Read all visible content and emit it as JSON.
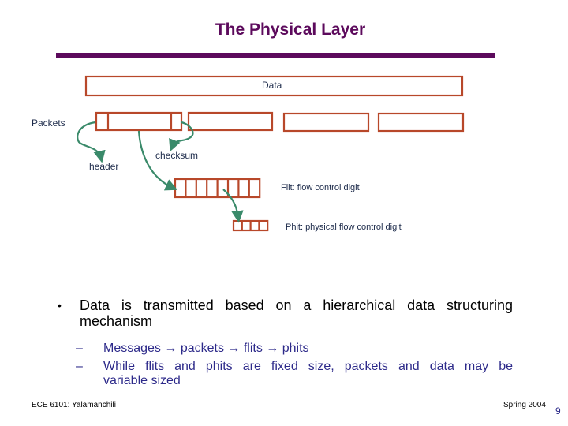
{
  "slide": {
    "title": "The Physical Layer",
    "accent_color": "#5c0a5c",
    "box_color": "#b8482a",
    "arrow_color": "#3a8a6a"
  },
  "diagram": {
    "data_label": "Data",
    "packets_label": "Packets",
    "packet_count": 4,
    "header_label": "header",
    "checksum_label": "checksum",
    "flit_label": "Flit: flow control digit",
    "flit_cell_count": 8,
    "phit_label": "Phit: physical flow control digit",
    "phit_cell_count": 4
  },
  "bullets": {
    "main": "Data is transmitted based on a hierarchical data structuring mechanism",
    "main_line1": "Data is transmitted based on a hierarchical data structuring",
    "main_line2": "mechanism",
    "sub": [
      "Messages → packets → flits → phits",
      "While flits and phits are fixed size, packets and data may be variable sized"
    ],
    "sub2_line1": "While flits and phits are fixed size, packets and data may be",
    "sub2_line2": "variable sized",
    "bullet_glyph": "•",
    "dash_glyph": "–"
  },
  "footer": {
    "left": "ECE 6101: Yalamanchili",
    "right": "Spring 2004",
    "page_number": "9"
  }
}
